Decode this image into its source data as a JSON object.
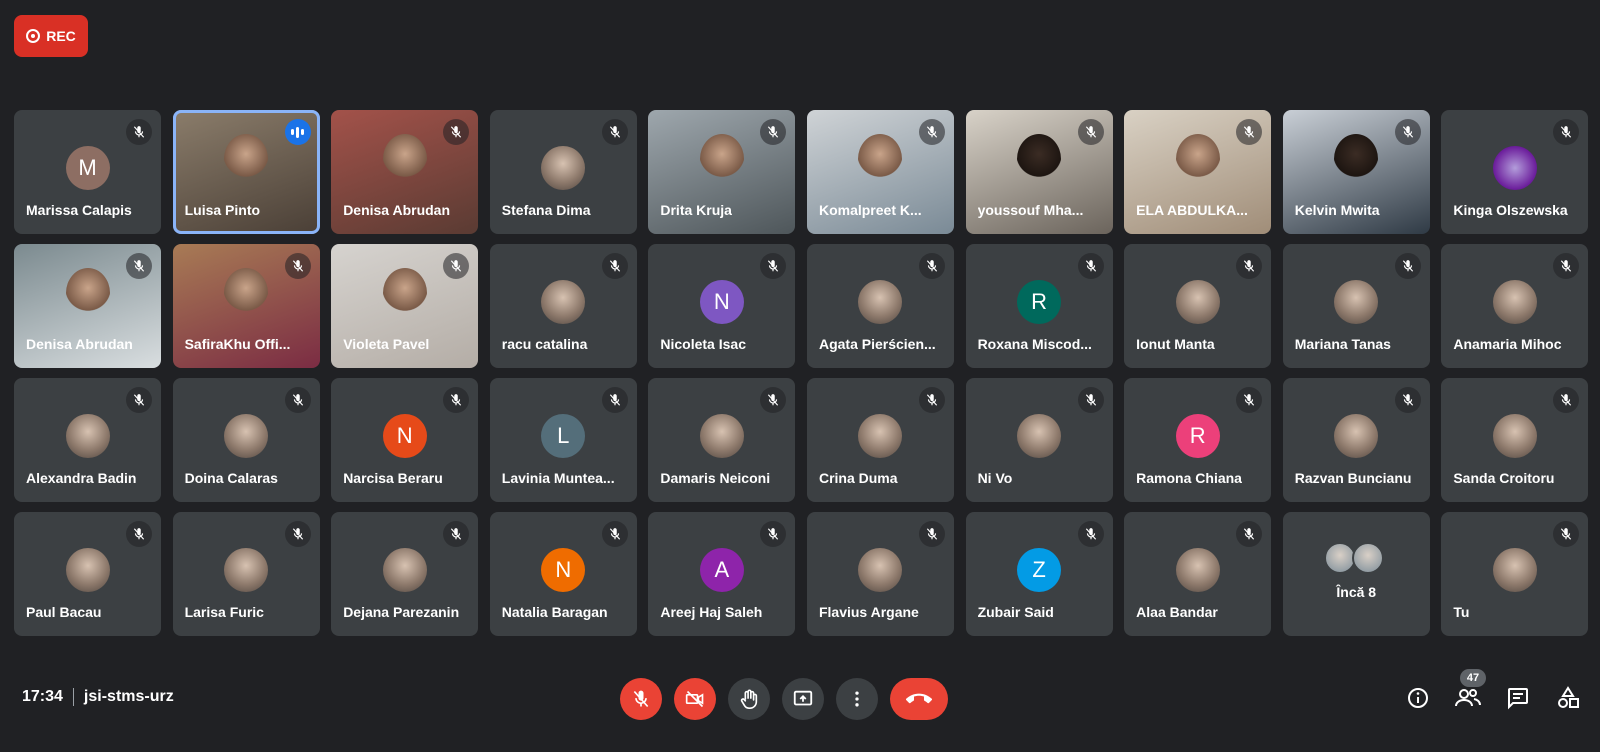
{
  "recording": {
    "label": "REC",
    "color": "#d93025"
  },
  "participants": [
    {
      "name": "Marissa Calapis",
      "type": "initial",
      "initial": "M",
      "color": "#8d6e63"
    },
    {
      "name": "Luisa Pinto",
      "type": "video",
      "speaking": true
    },
    {
      "name": "Denisa Abrudan",
      "type": "video"
    },
    {
      "name": "Stefana Dima",
      "type": "photo"
    },
    {
      "name": "Drita Kruja",
      "type": "video"
    },
    {
      "name": "Komalpreet K...",
      "type": "video"
    },
    {
      "name": "youssouf Mha...",
      "type": "video"
    },
    {
      "name": "ELA ABDULKA...",
      "type": "video"
    },
    {
      "name": "Kelvin Mwita",
      "type": "video"
    },
    {
      "name": "Kinga Olszewska",
      "type": "photo",
      "color": "#6a1b9a"
    },
    {
      "name": "Denisa Abrudan",
      "type": "video"
    },
    {
      "name": "SafiraKhu Offi...",
      "type": "video"
    },
    {
      "name": "Violeta Pavel",
      "type": "video"
    },
    {
      "name": "racu catalina",
      "type": "photo"
    },
    {
      "name": "Nicoleta Isac",
      "type": "initial",
      "initial": "N",
      "color": "#7e57c2"
    },
    {
      "name": "Agata Pierścien...",
      "type": "photo"
    },
    {
      "name": "Roxana Miscod...",
      "type": "initial",
      "initial": "R",
      "color": "#00695c"
    },
    {
      "name": "Ionut Manta",
      "type": "photo"
    },
    {
      "name": "Mariana Tanas",
      "type": "photo"
    },
    {
      "name": "Anamaria Mihoc",
      "type": "photo"
    },
    {
      "name": "Alexandra Badin",
      "type": "photo"
    },
    {
      "name": "Doina Calaras",
      "type": "photo"
    },
    {
      "name": "Narcisa Beraru",
      "type": "initial",
      "initial": "N",
      "color": "#e64a19"
    },
    {
      "name": "Lavinia Muntea...",
      "type": "initial",
      "initial": "L",
      "color": "#546e7a"
    },
    {
      "name": "Damaris Neiconi",
      "type": "photo"
    },
    {
      "name": "Crina Duma",
      "type": "photo"
    },
    {
      "name": "Ni Vo",
      "type": "photo"
    },
    {
      "name": "Ramona Chiana",
      "type": "initial",
      "initial": "R",
      "color": "#ec407a"
    },
    {
      "name": "Razvan Buncianu",
      "type": "photo"
    },
    {
      "name": "Sanda Croitoru",
      "type": "photo"
    },
    {
      "name": "Paul Bacau",
      "type": "photo"
    },
    {
      "name": "Larisa Furic",
      "type": "photo"
    },
    {
      "name": "Dejana Parezanin",
      "type": "photo"
    },
    {
      "name": "Natalia Baragan",
      "type": "initial",
      "initial": "N",
      "color": "#ef6c00"
    },
    {
      "name": "Areej Haj Saleh",
      "type": "initial",
      "initial": "A",
      "color": "#8e24aa"
    },
    {
      "name": "Flavius Argane",
      "type": "photo"
    },
    {
      "name": "Zubair Said",
      "type": "initial",
      "initial": "Z",
      "color": "#039be5"
    },
    {
      "name": "Alaa Bandar",
      "type": "photo"
    },
    {
      "name": "Încă 8",
      "type": "more"
    },
    {
      "name": "Tu",
      "type": "photo"
    }
  ],
  "footer": {
    "time": "17:34",
    "meeting_code": "jsi-stms-urz",
    "participant_count": "47"
  },
  "icons": {
    "mic": "mic-off-icon",
    "camera": "videocam-off-icon",
    "raise_hand": "hand-icon",
    "present": "present-screen-icon",
    "more": "more-vert-icon",
    "leave": "call-end-icon",
    "info": "info-icon",
    "people": "people-icon",
    "chat": "chat-icon",
    "activities": "activities-icon"
  },
  "colors": {
    "background": "#202124",
    "tile": "#3c4043",
    "danger": "#ea4335",
    "speaking": "#8ab4f8"
  }
}
